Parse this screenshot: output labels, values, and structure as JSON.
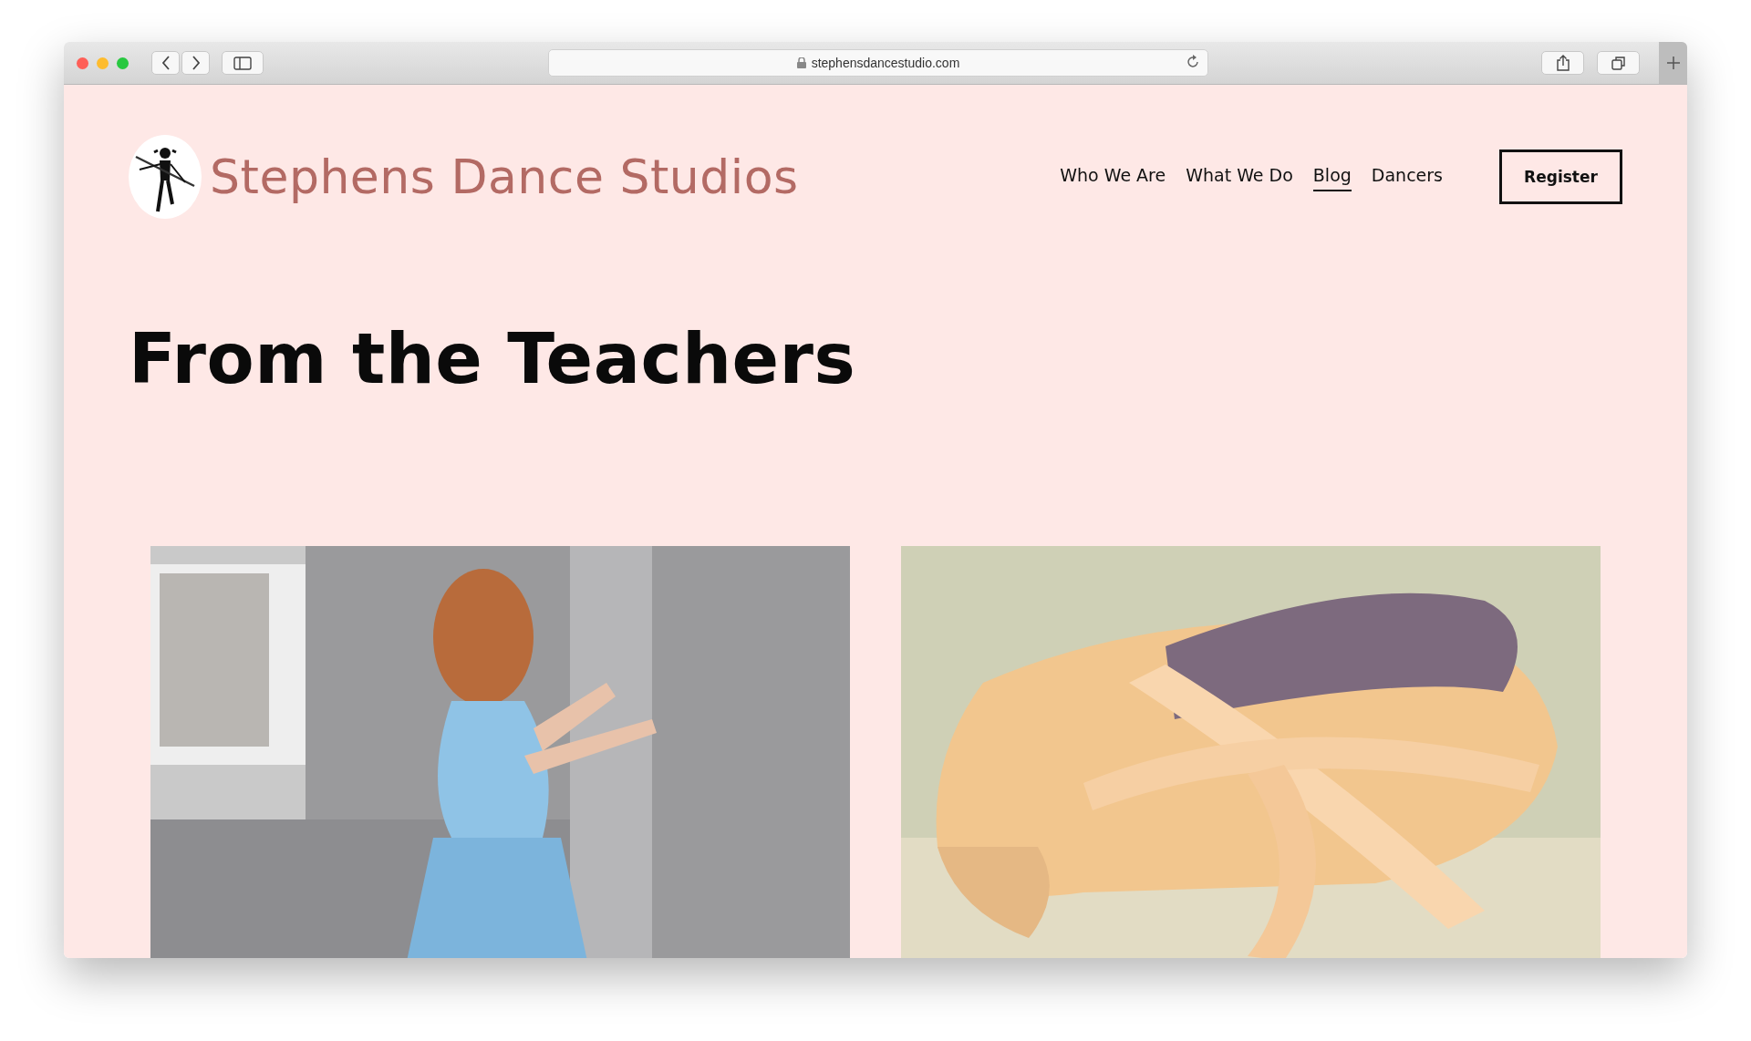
{
  "browser": {
    "url": "stephensdancestudio.com"
  },
  "site": {
    "title": "Stephens Dance Studios"
  },
  "nav": [
    {
      "label": "Who We Are",
      "selected": false
    },
    {
      "label": "What We Do",
      "selected": false
    },
    {
      "label": "Blog",
      "selected": true
    },
    {
      "label": "Dancers",
      "selected": false
    }
  ],
  "register_button": "Register",
  "heading": "From the Teachers"
}
